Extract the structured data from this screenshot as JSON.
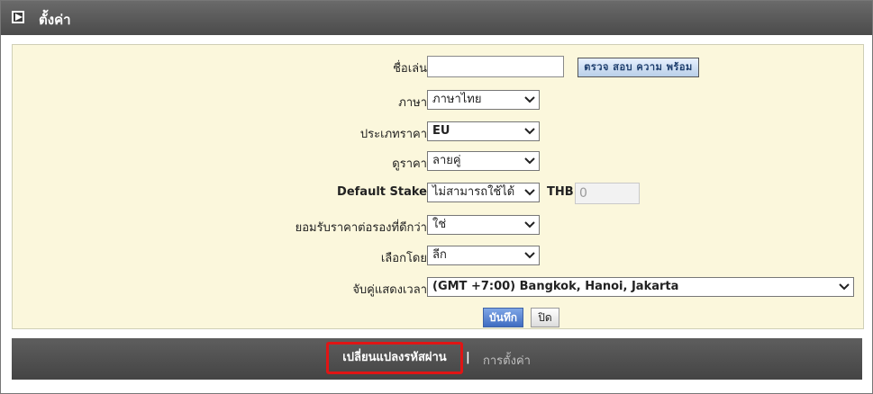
{
  "header": {
    "title": "ตั้งค่า",
    "icon": "play-icon"
  },
  "form": {
    "nickname": {
      "label": "ชื่อเล่น",
      "value": "",
      "check_button": "ตรวจ สอบ ความ พร้อม"
    },
    "language": {
      "label": "ภาษา",
      "selected": "ภาษาไทย"
    },
    "odds_type": {
      "label": "ประเภทราคา",
      "selected": "EU"
    },
    "view_odds": {
      "label": "ดูราคา",
      "selected": "ลายคู่"
    },
    "default_stake": {
      "label": "Default Stake",
      "selected": "ไม่สามารถใช้ได้",
      "currency": "THB",
      "amount": "0"
    },
    "accept_better_odds": {
      "label": "ยอมรับราคาต่อรองที่ดีกว่า",
      "selected": "ใช่"
    },
    "sort_by": {
      "label": "เลือกโดย",
      "selected": "ลีก"
    },
    "timezone": {
      "label": "จับคู่แสดงเวลา",
      "selected": "(GMT +7:00) Bangkok, Hanoi, Jakarta"
    }
  },
  "buttons": {
    "save": "บันทึก",
    "close": "ปิด"
  },
  "footer": {
    "change_password": "เปลี่ยนแปลงรหัสผ่าน",
    "separator": "|",
    "settings": "การตั้งค่า"
  },
  "colors": {
    "highlight_border": "#e01515",
    "form_background": "#fbf7dc",
    "bar": "#4b4b4b"
  }
}
